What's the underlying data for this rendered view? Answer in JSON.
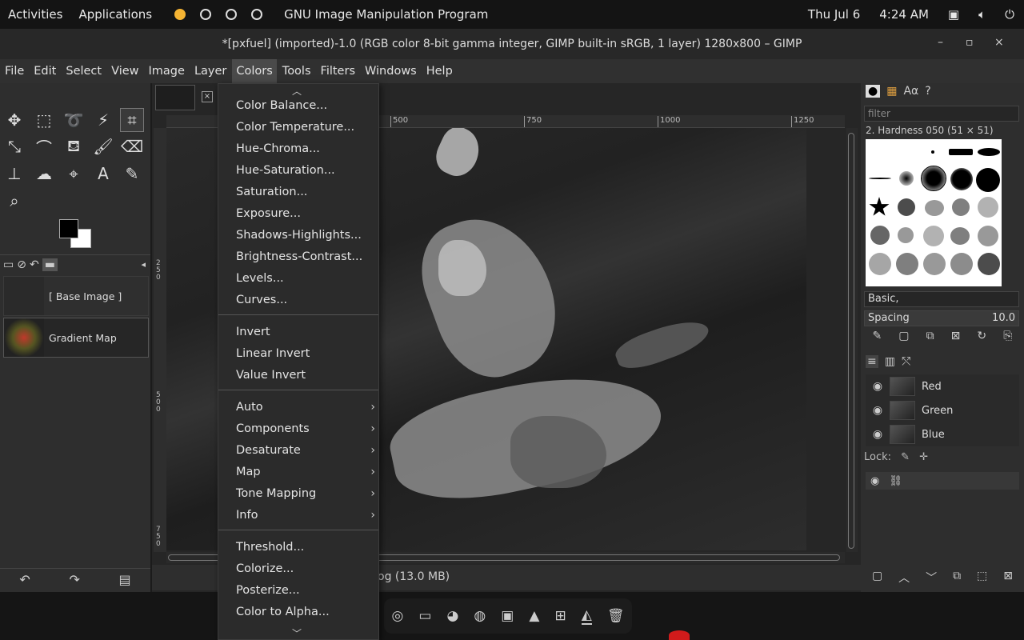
{
  "topbar": {
    "activities": "Activities",
    "applications": "Applications",
    "app_title": "GNU Image Manipulation Program",
    "date": "Thu Jul 6",
    "time": "4:24 AM"
  },
  "window": {
    "title": "*[pxfuel] (imported)-1.0 (RGB color 8-bit gamma integer, GIMP built-in sRGB, 1 layer) 1280x800 – GIMP",
    "minimize": "–",
    "maximize": "▫",
    "close": "×"
  },
  "menubar": [
    "File",
    "Edit",
    "Select",
    "View",
    "Image",
    "Layer",
    "Colors",
    "Tools",
    "Filters",
    "Windows",
    "Help"
  ],
  "colors_menu": {
    "group1": [
      "Color Balance...",
      "Color Temperature...",
      "Hue-Chroma...",
      "Hue-Saturation...",
      "Saturation...",
      "Exposure...",
      "Shadows-Highlights...",
      "Brightness-Contrast...",
      "Levels...",
      "Curves..."
    ],
    "group2": [
      "Invert",
      "Linear Invert",
      "Value Invert"
    ],
    "group3": [
      "Auto",
      "Components",
      "Desaturate",
      "Map",
      "Tone Mapping",
      "Info"
    ],
    "group4": [
      "Threshold...",
      "Colorize...",
      "Posterize...",
      "Color to Alpha..."
    ]
  },
  "channels_left": {
    "base_image": "[ Base Image ]",
    "gradient_map": "Gradient Map"
  },
  "rulers": {
    "h_labels": [
      "500",
      "750",
      "1000",
      "1250"
    ],
    "v_labels": [
      "250",
      "500",
      "750"
    ]
  },
  "status": {
    "text": "og (13.0 MB)"
  },
  "brushes": {
    "filter_placeholder": "filter",
    "current": "2. Hardness 050 (51 × 51)",
    "preset": "Basic,",
    "spacing_label": "Spacing",
    "spacing_value": "10.0"
  },
  "channels": [
    {
      "name": "Red"
    },
    {
      "name": "Green"
    },
    {
      "name": "Blue"
    }
  ],
  "lock_label": "Lock:"
}
